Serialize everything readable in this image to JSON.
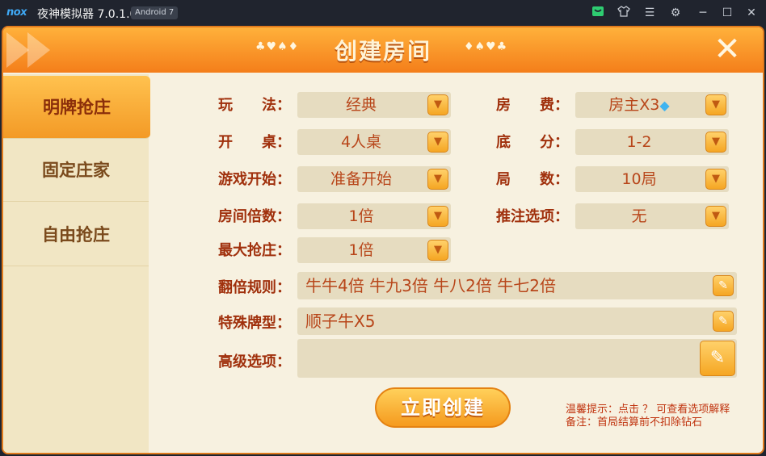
{
  "titlebar": {
    "logo": "nox",
    "title": "夜神模拟器 7.0.1.0",
    "badge": "Android 7",
    "icons": [
      "store-icon",
      "shirt-icon",
      "menu-icon",
      "gear-icon",
      "minimize-icon",
      "maximize-icon",
      "close-icon"
    ]
  },
  "dialog": {
    "title": "创建房间",
    "suits_left": "♣♥♠♦",
    "suits_right": "♦♠♥♣",
    "close_glyph": "✕"
  },
  "tabs": [
    {
      "label": "明牌抢庄",
      "active": true
    },
    {
      "label": "固定庄家",
      "active": false
    },
    {
      "label": "自由抢庄",
      "active": false
    }
  ],
  "form": {
    "play_label": "玩　　法：",
    "play_value": "经典",
    "fee_label": "房　　费：",
    "fee_value": "房主X3",
    "table_label": "开　　桌：",
    "table_value": "4人桌",
    "base_label": "底　　分：",
    "base_value": "1-2",
    "start_label": "游戏开始：",
    "start_value": "准备开始",
    "rounds_label": "局　　数：",
    "rounds_value": "10局",
    "multiplier_label": "房间倍数：",
    "multiplier_value": "1倍",
    "push_label": "推注选项：",
    "push_value": "无",
    "maxbank_label": "最大抢庄：",
    "maxbank_value": "1倍",
    "double_label": "翻倍规则：",
    "double_value": "牛牛4倍 牛九3倍 牛八2倍 牛七2倍",
    "special_label": "特殊牌型：",
    "special_value": "顺子牛X5",
    "advanced_label": "高级选项：",
    "advanced_value": ""
  },
  "create_button": "立即创建",
  "tips": {
    "line1": "温馨提示：点击 ？ 可查看选项解释",
    "line2": "备注：首局结算前不扣除钻石"
  },
  "colors": {
    "accent": "#f47e1a",
    "label": "#a0300c",
    "value": "#b8461a",
    "panel": "#f7f1e0"
  }
}
